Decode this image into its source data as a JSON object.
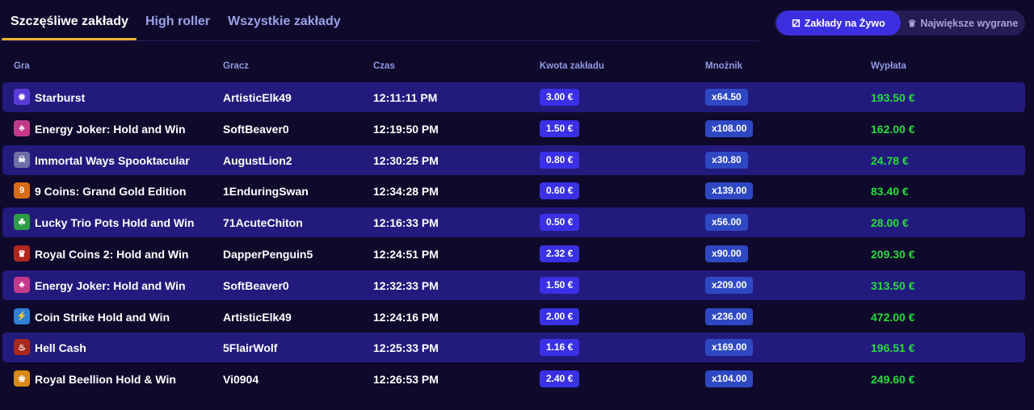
{
  "tabs": [
    "Szczęśliwe zakłady",
    "High roller",
    "Wszystkie zakłady"
  ],
  "toggle": {
    "live_label": "Zakłady na Żywo",
    "biggest_label": "Największe wygrane"
  },
  "columns": {
    "game": "Gra",
    "player": "Gracz",
    "time": "Czas",
    "bet": "Kwota zakładu",
    "multiplier": "Mnożnik",
    "payout": "Wypłata"
  },
  "rows": [
    {
      "game": "Starburst",
      "player": "ArtisticElk49",
      "time": "12:11:11 PM",
      "bet": "3.00 €",
      "multiplier": "x64.50",
      "payout": "193.50 €",
      "icon": "starburst-icon",
      "icon_color": "#5b3bd8"
    },
    {
      "game": "Energy Joker: Hold and Win",
      "player": "SoftBeaver0",
      "time": "12:19:50 PM",
      "bet": "1.50 €",
      "multiplier": "x108.00",
      "payout": "162.00 €",
      "icon": "joker-icon",
      "icon_color": "#c43a8a"
    },
    {
      "game": "Immortal Ways Spooktacular",
      "player": "AugustLion2",
      "time": "12:30:25 PM",
      "bet": "0.80 €",
      "multiplier": "x30.80",
      "payout": "24.78 €",
      "icon": "ghost-icon",
      "icon_color": "#6f6fa8"
    },
    {
      "game": "9 Coins: Grand Gold Edition",
      "player": "1EnduringSwan",
      "time": "12:34:28 PM",
      "bet": "0.60 €",
      "multiplier": "x139.00",
      "payout": "83.40 €",
      "icon": "coin-icon",
      "icon_color": "#d96a18"
    },
    {
      "game": "Lucky Trio Pots Hold and Win",
      "player": "71AcuteChiton",
      "time": "12:16:33 PM",
      "bet": "0.50 €",
      "multiplier": "x56.00",
      "payout": "28.00 €",
      "icon": "pot-icon",
      "icon_color": "#2f9c46"
    },
    {
      "game": "Royal Coins 2: Hold and Win",
      "player": "DapperPenguin5",
      "time": "12:24:51 PM",
      "bet": "2.32 €",
      "multiplier": "x90.00",
      "payout": "209.30 €",
      "icon": "crown-coin-icon",
      "icon_color": "#b3261e"
    },
    {
      "game": "Energy Joker: Hold and Win",
      "player": "SoftBeaver0",
      "time": "12:32:33 PM",
      "bet": "1.50 €",
      "multiplier": "x209.00",
      "payout": "313.50 €",
      "icon": "joker-icon",
      "icon_color": "#c43a8a"
    },
    {
      "game": "Coin Strike Hold and Win",
      "player": "ArtisticElk49",
      "time": "12:24:16 PM",
      "bet": "2.00 €",
      "multiplier": "x236.00",
      "payout": "472.00 €",
      "icon": "lightning-coin-icon",
      "icon_color": "#2f7fd6"
    },
    {
      "game": "Hell Cash",
      "player": "5FlairWolf",
      "time": "12:25:33 PM",
      "bet": "1.16 €",
      "multiplier": "x169.00",
      "payout": "196.51 €",
      "icon": "fire-icon",
      "icon_color": "#a8281c"
    },
    {
      "game": "Royal Beellion Hold & Win",
      "player": "Vi0904",
      "time": "12:26:53 PM",
      "bet": "2.40 €",
      "multiplier": "x104.00",
      "payout": "249.60 €",
      "icon": "bee-icon",
      "icon_color": "#d98a14"
    }
  ]
}
